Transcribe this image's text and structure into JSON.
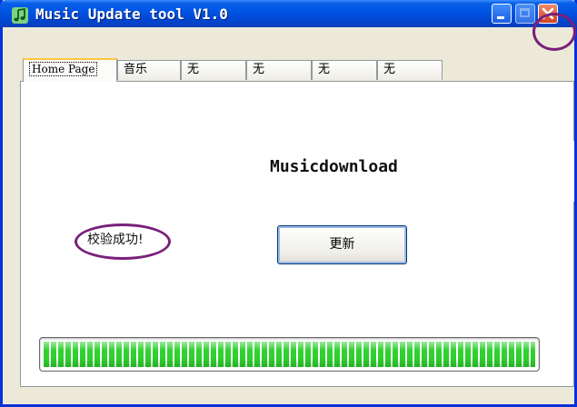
{
  "window": {
    "title": "Music Update tool V1.0",
    "icon": "music-note-icon",
    "controls": [
      "minimize-icon",
      "maximize-icon",
      "close-icon"
    ]
  },
  "tabs": [
    {
      "label": "Home Page",
      "active": true
    },
    {
      "label": "音乐",
      "active": false
    },
    {
      "label": "无",
      "active": false
    },
    {
      "label": "无",
      "active": false
    },
    {
      "label": "无",
      "active": false
    },
    {
      "label": "无",
      "active": false
    }
  ],
  "main": {
    "heading": "Musicdownload",
    "status": "校验成功!",
    "update_button": "更新",
    "progress_fraction": 1.0
  },
  "colors": {
    "titlebar": "#0055e5",
    "annotation": "#7a1f7a",
    "progress": "#2ed12e"
  }
}
